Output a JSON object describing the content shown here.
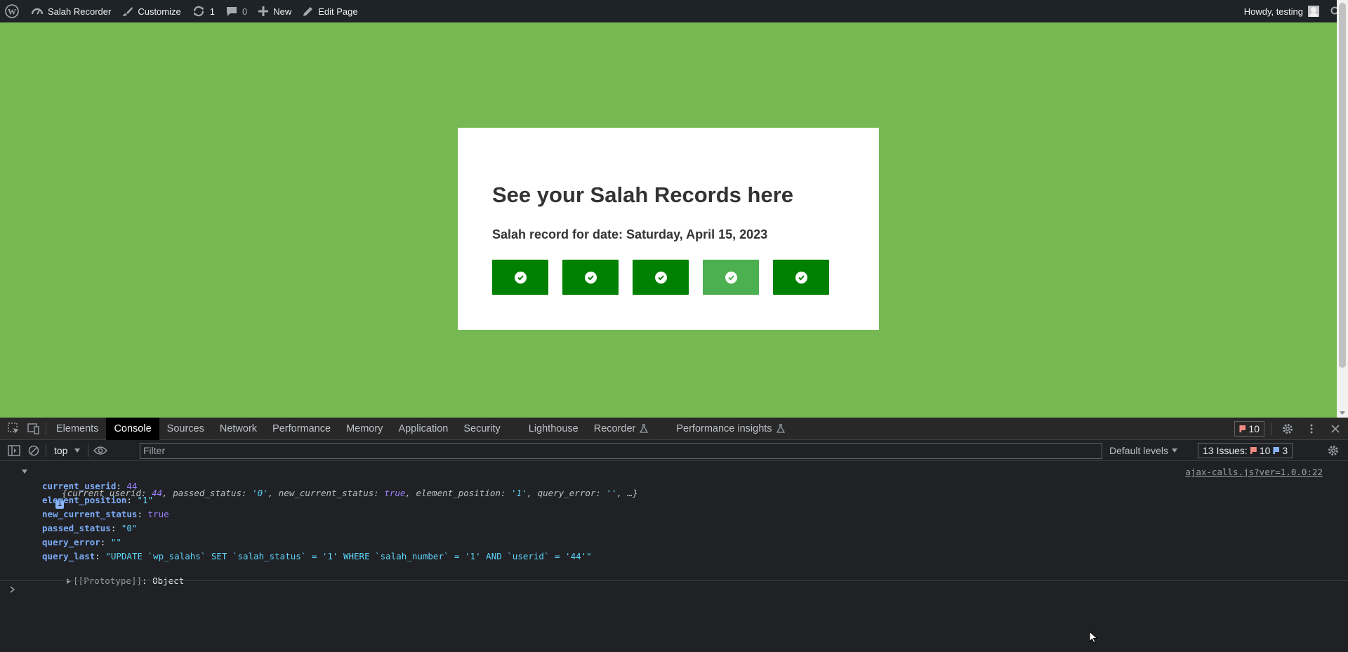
{
  "adminbar": {
    "site_name": "Salah Recorder",
    "customize": "Customize",
    "updates_count": "1",
    "comments_count": "0",
    "new": "New",
    "edit_page": "Edit Page",
    "greeting": "Howdy, testing"
  },
  "page": {
    "background": "#76b852",
    "heading": "See your Salah Records here",
    "subheading": "Salah record for date: Saturday, April 15, 2023",
    "salah_buttons": [
      {
        "status": "done",
        "color": "#008000"
      },
      {
        "status": "done",
        "color": "#008000"
      },
      {
        "status": "done",
        "color": "#008000"
      },
      {
        "status": "hover",
        "color": "#4caf50"
      },
      {
        "status": "done",
        "color": "#008000"
      }
    ]
  },
  "devtools": {
    "tabs": [
      "Elements",
      "Console",
      "Sources",
      "Network",
      "Performance",
      "Memory",
      "Application",
      "Security",
      "Lighthouse",
      "Recorder",
      "Performance insights"
    ],
    "active_tab": "Console",
    "error_count": "10",
    "context": "top",
    "filter_placeholder": "Filter",
    "levels": "Default levels",
    "issues_label": "13 Issues:",
    "issues_errors": "10",
    "issues_info": "3",
    "console": {
      "summary_prefix": "{",
      "summary": [
        {
          "k": "current_userid",
          "v": "44",
          "t": "num"
        },
        {
          "k": "passed_status",
          "v": "'0'",
          "t": "str"
        },
        {
          "k": "new_current_status",
          "v": "true",
          "t": "kw"
        },
        {
          "k": "element_position",
          "v": "'1'",
          "t": "str"
        },
        {
          "k": "query_error",
          "v": "''",
          "t": "str"
        }
      ],
      "summary_suffix": "…}",
      "source": "ajax-calls.js?ver=1.0.0:22",
      "props": [
        {
          "k": "current_userid",
          "v": "44",
          "t": "num"
        },
        {
          "k": "element_position",
          "v": "\"1\"",
          "t": "str"
        },
        {
          "k": "new_current_status",
          "v": "true",
          "t": "kw"
        },
        {
          "k": "passed_status",
          "v": "\"0\"",
          "t": "str"
        },
        {
          "k": "query_error",
          "v": "\"\"",
          "t": "str"
        },
        {
          "k": "query_last",
          "v": "\"UPDATE `wp_salahs` SET `salah_status` = '1' WHERE `salah_number` = '1' AND `userid` = '44'\"",
          "t": "str"
        }
      ],
      "prototype_label": "[[Prototype]]",
      "prototype_value": "Object"
    }
  }
}
